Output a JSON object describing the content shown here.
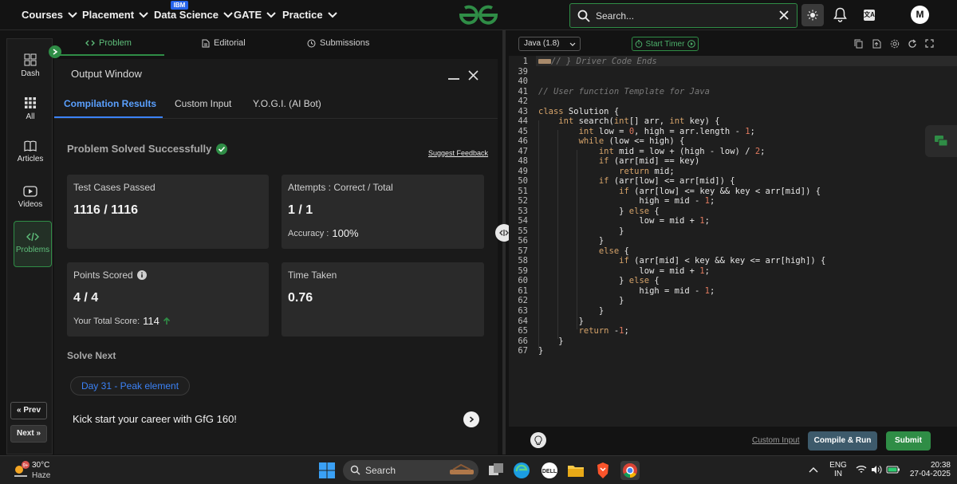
{
  "topnav": {
    "items": [
      {
        "label": "Courses"
      },
      {
        "label": "Placement"
      },
      {
        "label": "Data Science"
      },
      {
        "label": "GATE"
      },
      {
        "label": "Practice"
      }
    ],
    "ibm_badge": "IBM",
    "search_placeholder": "Search...",
    "avatar_initial": "M"
  },
  "rail": {
    "items": [
      {
        "label": "Dash"
      },
      {
        "label": "All"
      },
      {
        "label": "Articles"
      },
      {
        "label": "Videos"
      },
      {
        "label": "Problems"
      }
    ],
    "prev": "Prev",
    "next": "Next"
  },
  "panel_tabs": {
    "problem": "Problem",
    "editorial": "Editorial",
    "submissions": "Submissions"
  },
  "output": {
    "title": "Output Window",
    "tabs": [
      "Compilation Results",
      "Custom Input",
      "Y.O.G.I. (AI Bot)"
    ],
    "status": "Problem Solved Successfully",
    "feedback": "Suggest Feedback",
    "test_cases_label": "Test Cases Passed",
    "test_cases_value": "1116 / 1116",
    "attempts_label": "Attempts : Correct / Total",
    "attempts_value": "1 / 1",
    "accuracy_label": "Accuracy :",
    "accuracy_value": "100%",
    "points_label": "Points Scored",
    "points_value": "4 / 4",
    "total_score_label": "Your Total Score:",
    "total_score_value": "114",
    "time_label": "Time Taken",
    "time_value": "0.76",
    "solve_next": "Solve Next",
    "next_problem": "Day 31 - Peak element",
    "kickstart": "Kick start your career with GfG 160!"
  },
  "editor": {
    "language": "Java (1.8)",
    "timer": "Start Timer",
    "custom_input": "Custom Input",
    "compile_run": "Compile & Run",
    "submit": "Submit"
  },
  "code_lines": [
    {
      "n": "1",
      "html": "<span class=\"folded\"></span><span class=\"cm\">// } Driver Code Ends</span>"
    },
    {
      "n": "39",
      "html": ""
    },
    {
      "n": "40",
      "html": ""
    },
    {
      "n": "41",
      "html": "<span class=\"cm\">// User function Template for Java</span>"
    },
    {
      "n": "42",
      "html": ""
    },
    {
      "n": "43",
      "html": "<span class=\"kw\">class</span> Solution {"
    },
    {
      "n": "44",
      "html": "    <span class=\"kw\">int</span> search(<span class=\"kw\">int</span>[] arr, <span class=\"kw\">int</span> key) {"
    },
    {
      "n": "45",
      "html": "        <span class=\"kw\">int</span> low = <span class=\"nm\">0</span>, high = arr.length - <span class=\"nm\">1</span>;"
    },
    {
      "n": "46",
      "html": "        <span class=\"kw\">while</span> (low &lt;= high) {"
    },
    {
      "n": "47",
      "html": "            <span class=\"kw\">int</span> mid = low + (high - low) / <span class=\"nm\">2</span>;"
    },
    {
      "n": "48",
      "html": "            <span class=\"kw\">if</span> (arr[mid] == key)"
    },
    {
      "n": "49",
      "html": "                <span class=\"kw\">return</span> mid;"
    },
    {
      "n": "50",
      "html": "            <span class=\"kw\">if</span> (arr[low] &lt;= arr[mid]) {"
    },
    {
      "n": "51",
      "html": "                <span class=\"kw\">if</span> (arr[low] &lt;= key &amp;&amp; key &lt; arr[mid]) {"
    },
    {
      "n": "52",
      "html": "                    high = mid - <span class=\"nm\">1</span>;"
    },
    {
      "n": "53",
      "html": "                } <span class=\"kw\">else</span> {"
    },
    {
      "n": "54",
      "html": "                    low = mid + <span class=\"nm\">1</span>;"
    },
    {
      "n": "55",
      "html": "                }"
    },
    {
      "n": "56",
      "html": "            }"
    },
    {
      "n": "57",
      "html": "            <span class=\"kw\">else</span> {"
    },
    {
      "n": "58",
      "html": "                <span class=\"kw\">if</span> (arr[mid] &lt; key &amp;&amp; key &lt;= arr[high]) {"
    },
    {
      "n": "59",
      "html": "                    low = mid + <span class=\"nm\">1</span>;"
    },
    {
      "n": "60",
      "html": "                } <span class=\"kw\">else</span> {"
    },
    {
      "n": "61",
      "html": "                    high = mid - <span class=\"nm\">1</span>;"
    },
    {
      "n": "62",
      "html": "                }"
    },
    {
      "n": "63",
      "html": "            }"
    },
    {
      "n": "64",
      "html": "        }"
    },
    {
      "n": "65",
      "html": "        <span class=\"kw\">return</span> -<span class=\"nm\">1</span>;"
    },
    {
      "n": "66",
      "html": "    }"
    },
    {
      "n": "67",
      "html": "}"
    }
  ],
  "taskbar": {
    "temp": "30°C",
    "weather": "Haze",
    "weather_badge": "9+",
    "search": "Search",
    "lang1": "ENG",
    "lang2": "IN",
    "time": "20:38",
    "date": "27-04-2025"
  },
  "colors": {
    "accent_green": "#2f8d46",
    "link_blue": "#3b82f6",
    "background": "#131313"
  },
  "icons": [
    "chevron-down-icon",
    "gfg-logo",
    "search-icon",
    "close-icon",
    "sun-icon",
    "bell-icon",
    "translate-icon",
    "dashboard-icon",
    "grid-icon",
    "book-icon",
    "video-icon",
    "code-icon",
    "file-icon",
    "clock-icon",
    "check-circle-icon",
    "info-icon",
    "arrow-up-icon",
    "chevron-right-icon",
    "play-circle-icon",
    "copy-icon",
    "upload-icon",
    "settings-icon",
    "refresh-icon",
    "fullscreen-icon",
    "chat-icon",
    "bulb-icon"
  ]
}
